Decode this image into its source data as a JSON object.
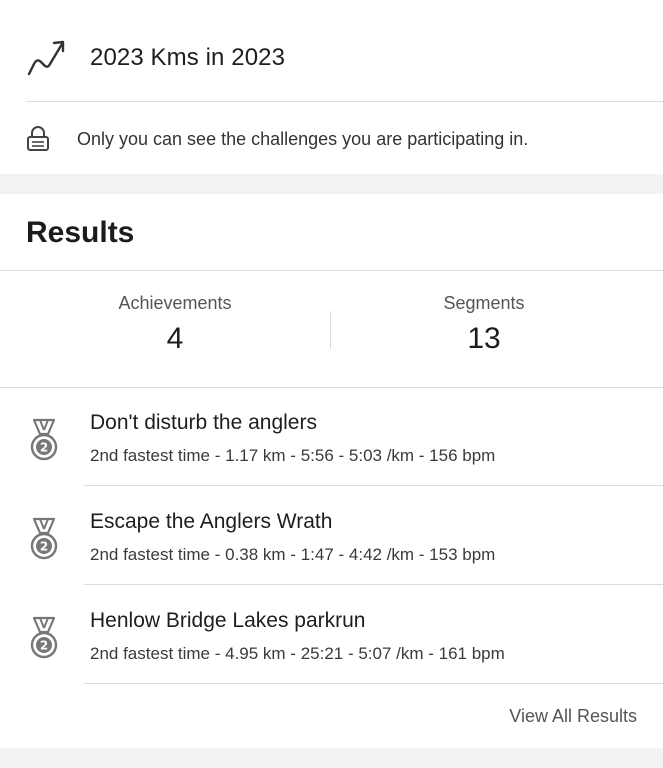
{
  "challenge": {
    "icon": "trend-up-arrow-icon",
    "title": "2023 Kms in 2023"
  },
  "privacy": {
    "icon": "lock-icon",
    "text": "Only you can see the challenges you are participating in."
  },
  "results": {
    "title": "Results",
    "stats": {
      "achievements_label": "Achievements",
      "achievements_value": "4",
      "segments_label": "Segments",
      "segments_value": "13"
    },
    "items": [
      {
        "icon": "medal-2nd-icon",
        "title": "Don't disturb the anglers",
        "detail": "2nd fastest time - 1.17 km - 5:56 - 5:03 /km - 156 bpm"
      },
      {
        "icon": "medal-2nd-icon",
        "title": "Escape the Anglers Wrath",
        "detail": "2nd fastest time - 0.38 km - 1:47 - 4:42 /km - 153 bpm"
      },
      {
        "icon": "medal-2nd-icon",
        "title": "Henlow Bridge Lakes parkrun",
        "detail": "2nd fastest time - 4.95 km - 25:21 - 5:07 /km - 161 bpm"
      }
    ],
    "view_all_label": "View All Results"
  },
  "colors": {
    "text": "#1c1c1c",
    "muted": "#555555",
    "divider": "#dcdcdc",
    "band": "#f2f2f4"
  }
}
